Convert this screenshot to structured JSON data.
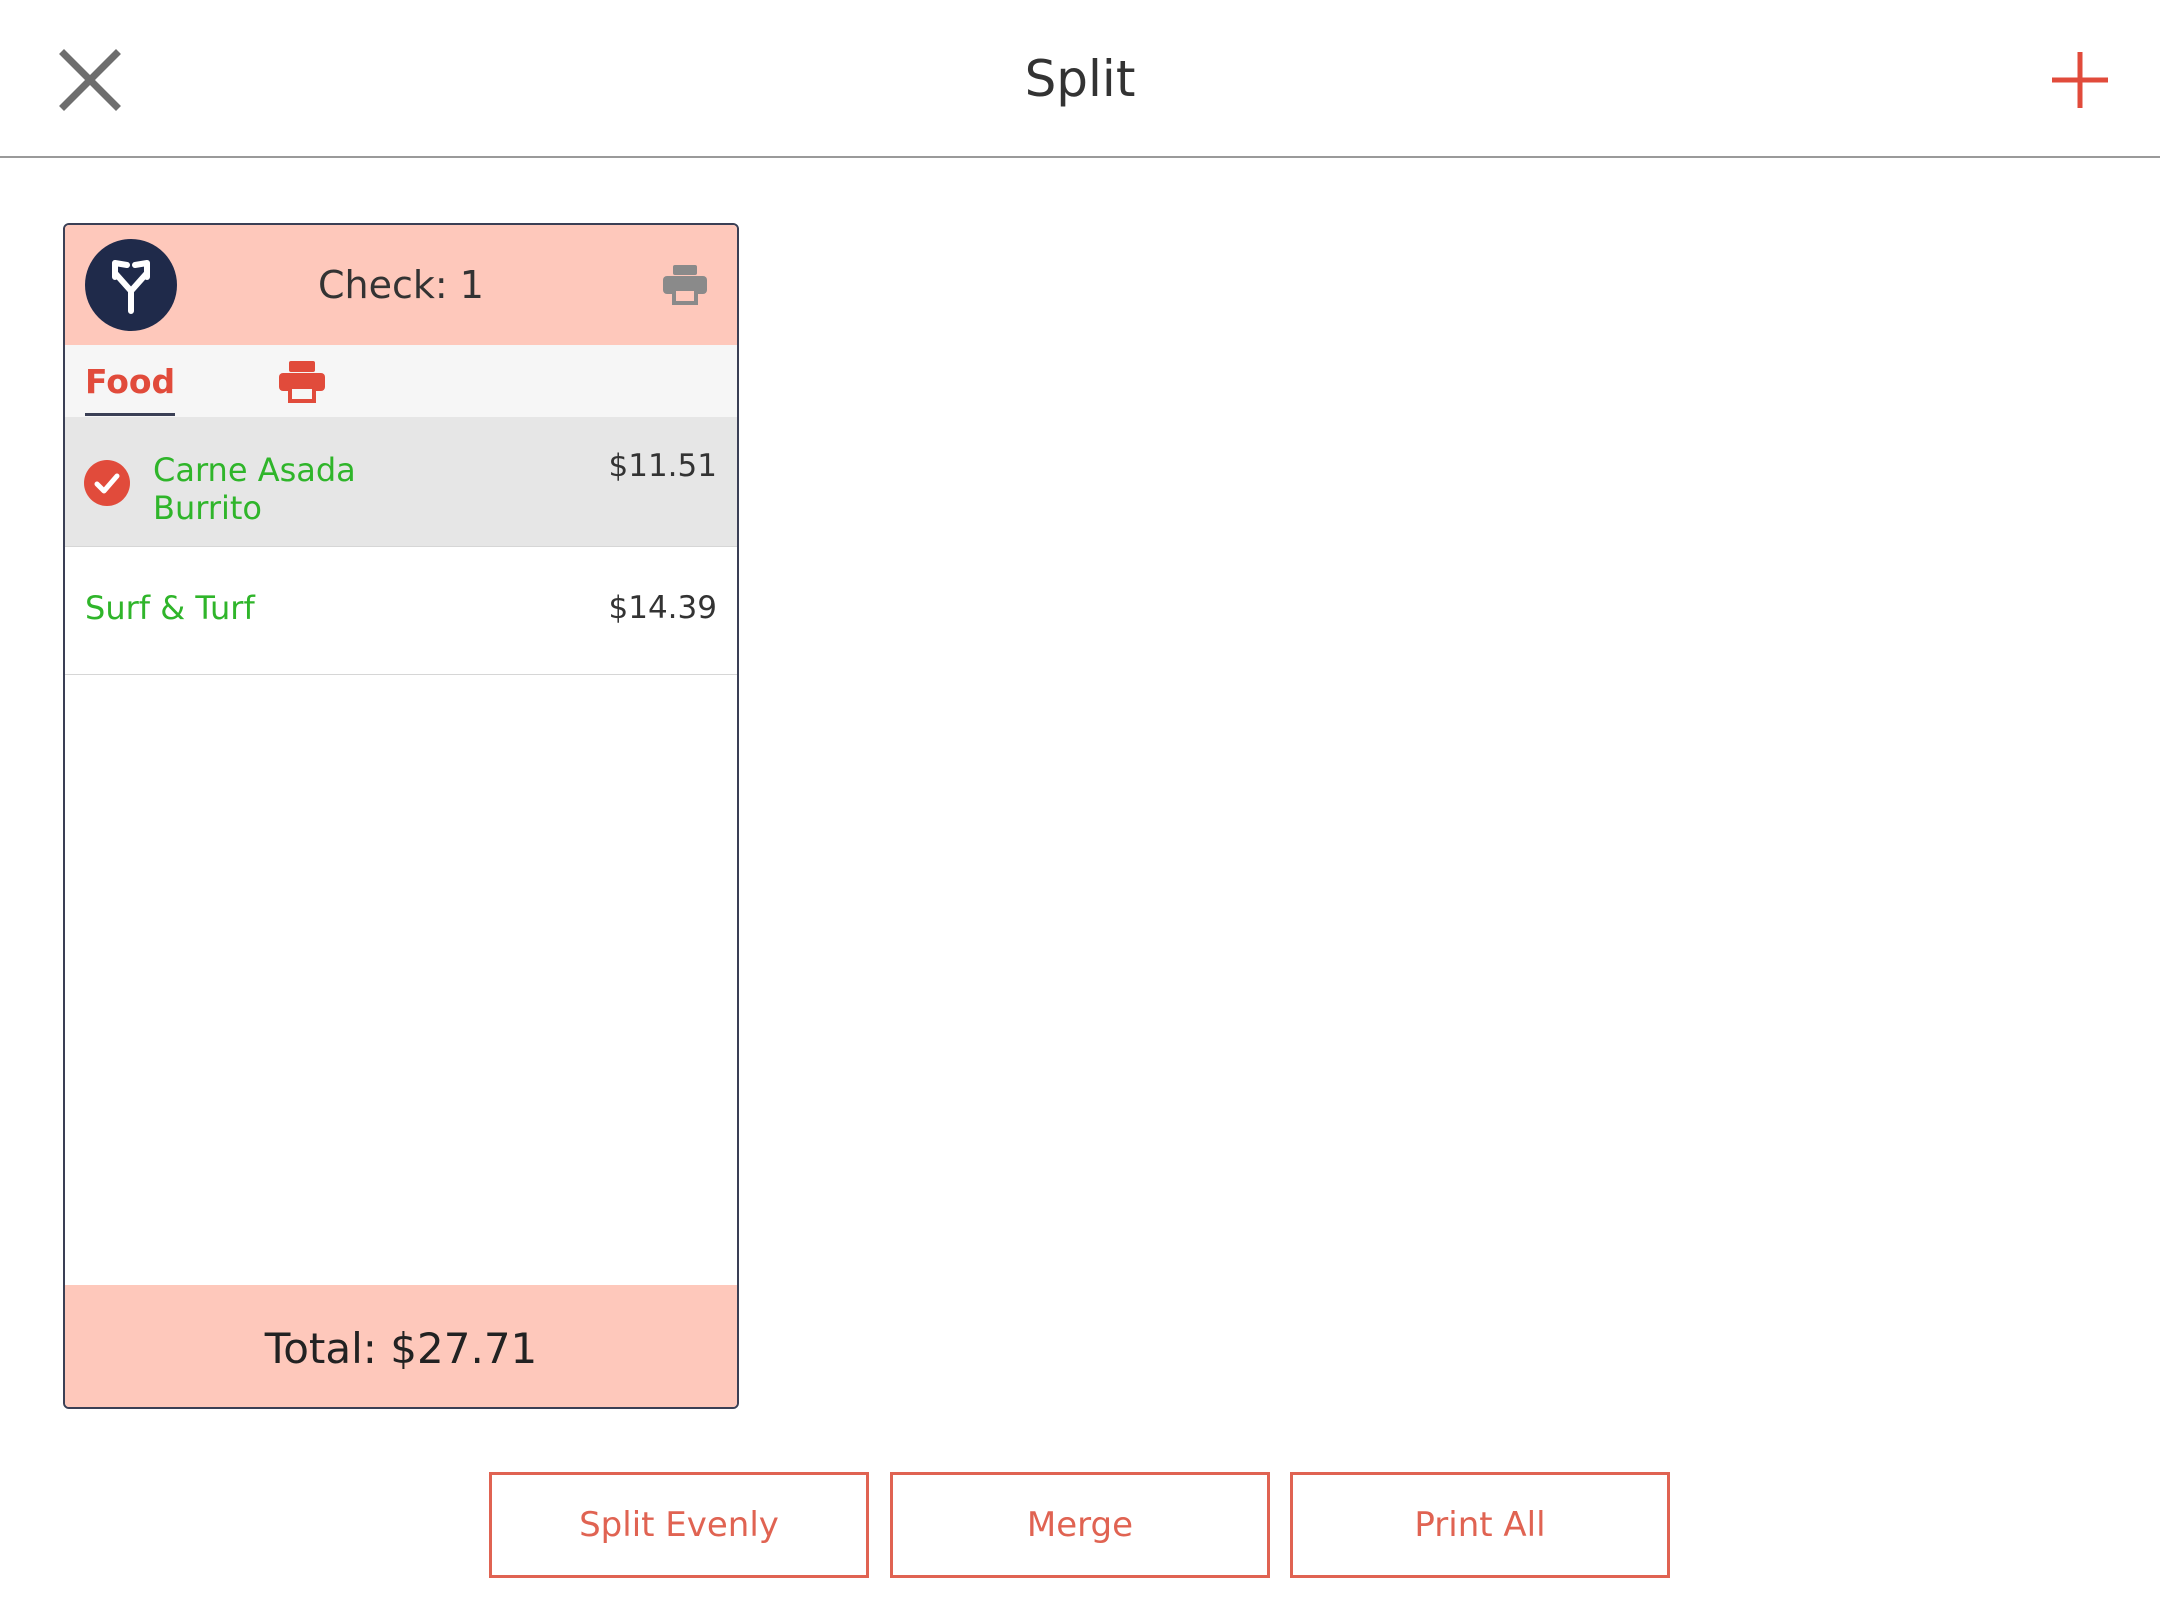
{
  "header": {
    "title": "Split",
    "close_icon": "close-icon",
    "add_icon": "plus-icon"
  },
  "check": {
    "title": "Check: 1",
    "split_icon": "split-arrows-icon",
    "print_icon": "printer-icon",
    "category": {
      "label": "Food",
      "print_icon": "printer-icon"
    },
    "items": [
      {
        "name": "Carne Asada Burrito",
        "price": "$11.51",
        "selected": true
      },
      {
        "name": "Surf & Turf",
        "price": "$14.39",
        "selected": false
      }
    ],
    "total": "Total: $27.71"
  },
  "actions": {
    "split_evenly": "Split Evenly",
    "merge": "Merge",
    "print_all": "Print All"
  },
  "colors": {
    "accent": "#e06352",
    "header_bg": "#fec8bb",
    "item_text": "#2fb52a",
    "avatar_bg": "#1f2a4a"
  }
}
